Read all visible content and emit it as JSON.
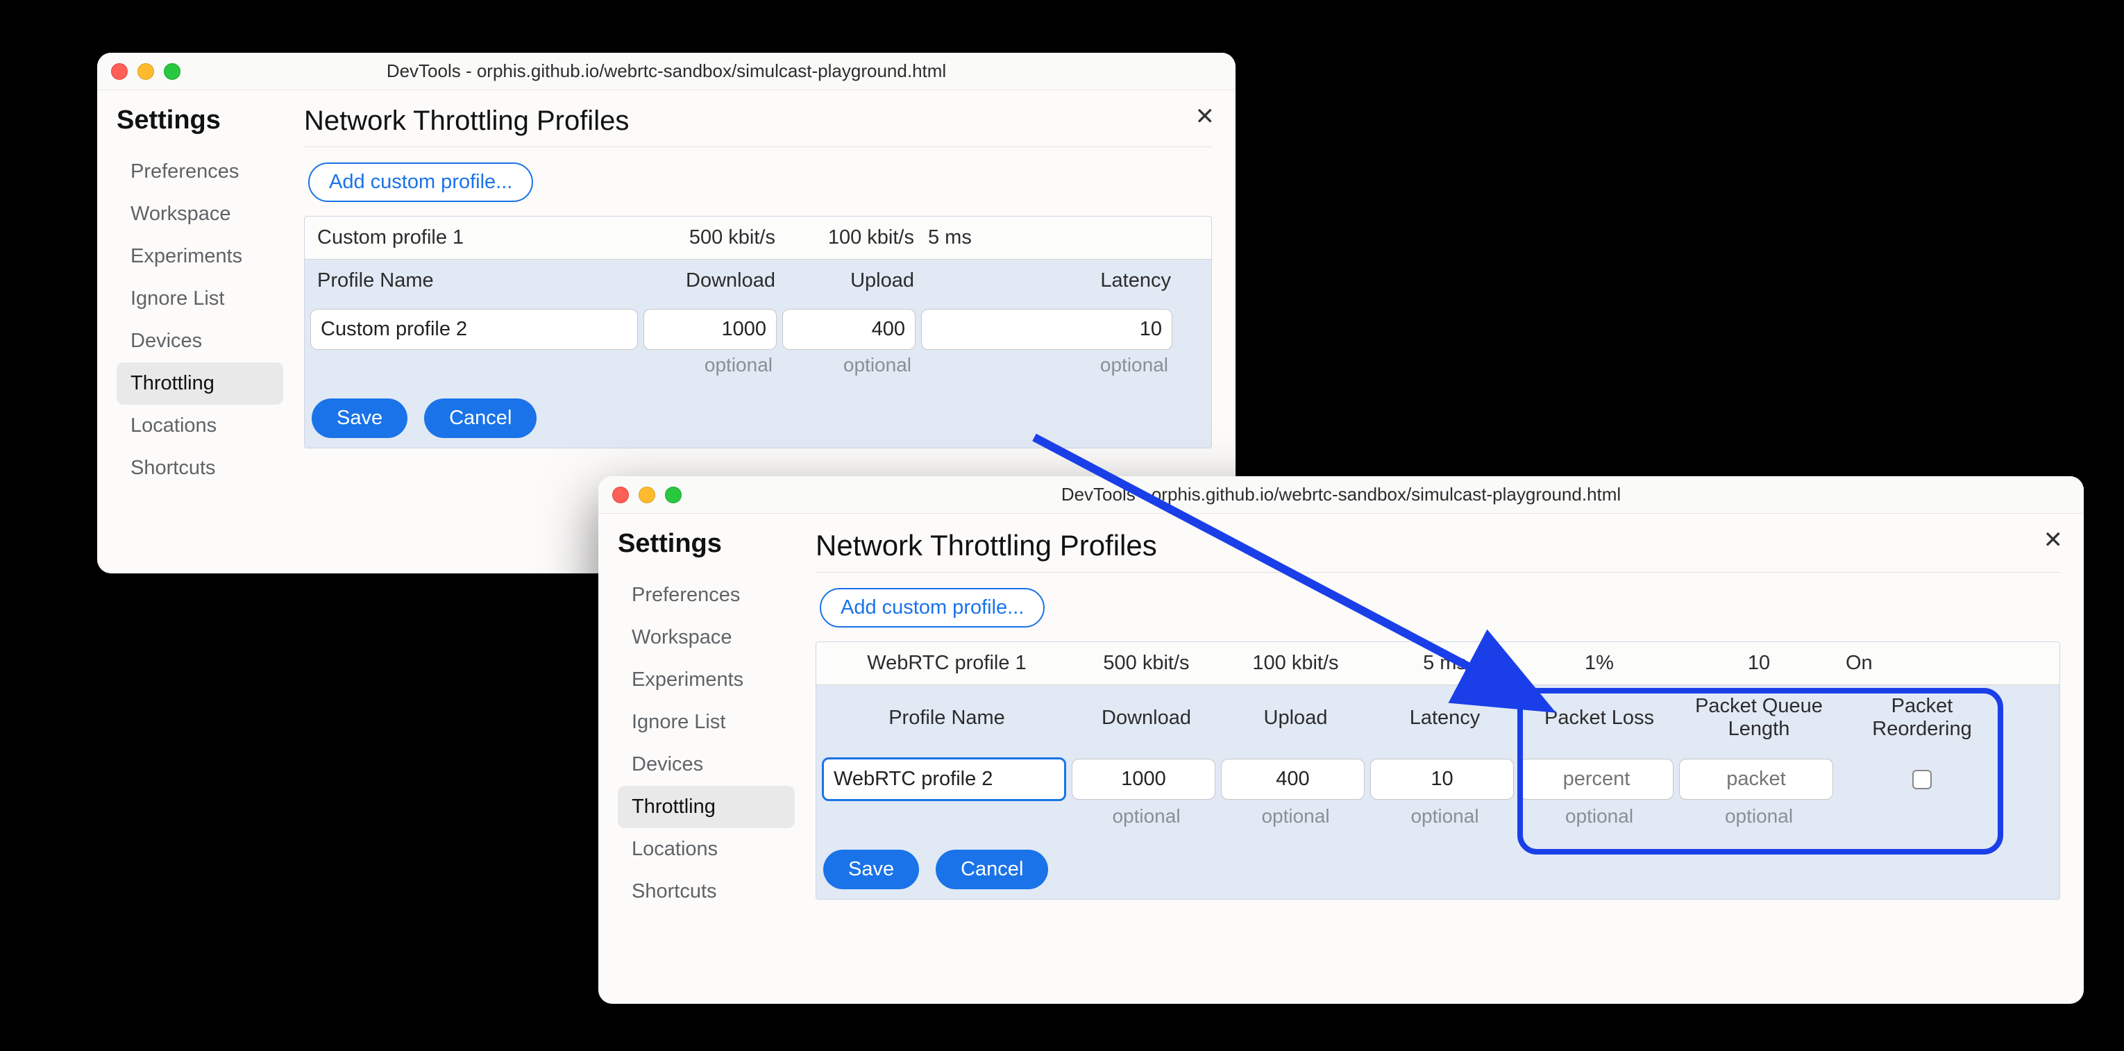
{
  "windowA": {
    "title": "DevTools - orphis.github.io/webrtc-sandbox/simulcast-playground.html",
    "sidebar": {
      "title": "Settings",
      "items": [
        "Preferences",
        "Workspace",
        "Experiments",
        "Ignore List",
        "Devices",
        "Throttling",
        "Locations",
        "Shortcuts"
      ],
      "activeIndex": 5
    },
    "pageTitle": "Network Throttling Profiles",
    "addButton": "Add custom profile...",
    "header": {
      "name": "Profile Name",
      "download": "Download",
      "upload": "Upload",
      "latency": "Latency"
    },
    "existing": {
      "name": "Custom profile 1",
      "download": "500 kbit/s",
      "upload": "100 kbit/s",
      "latency": "5 ms"
    },
    "editing": {
      "name": "Custom profile 2",
      "download": "1000",
      "upload": "400",
      "latency": "10"
    },
    "hints": {
      "download": "optional",
      "upload": "optional",
      "latency": "optional"
    },
    "save": "Save",
    "cancel": "Cancel"
  },
  "windowB": {
    "title": "DevTools - orphis.github.io/webrtc-sandbox/simulcast-playground.html",
    "sidebar": {
      "title": "Settings",
      "items": [
        "Preferences",
        "Workspace",
        "Experiments",
        "Ignore List",
        "Devices",
        "Throttling",
        "Locations",
        "Shortcuts"
      ],
      "activeIndex": 5
    },
    "pageTitle": "Network Throttling Profiles",
    "addButton": "Add custom profile...",
    "header": {
      "name": "Profile Name",
      "download": "Download",
      "upload": "Upload",
      "latency": "Latency",
      "packetLoss": "Packet Loss",
      "packetQueue": "Packet Queue Length",
      "packetReorder": "Packet Reordering"
    },
    "existing": {
      "name": "WebRTC profile 1",
      "download": "500 kbit/s",
      "upload": "100 kbit/s",
      "latency": "5 ms",
      "packetLoss": "1%",
      "packetQueue": "10",
      "packetReorder": "On"
    },
    "editing": {
      "name": "WebRTC profile 2",
      "download": "1000",
      "upload": "400",
      "latency": "10",
      "packetLossPlaceholder": "percent",
      "packetQueuePlaceholder": "packet",
      "packetReorderChecked": false
    },
    "hints": {
      "download": "optional",
      "upload": "optional",
      "latency": "optional",
      "packetLoss": "optional",
      "packetQueue": "optional"
    },
    "save": "Save",
    "cancel": "Cancel"
  }
}
